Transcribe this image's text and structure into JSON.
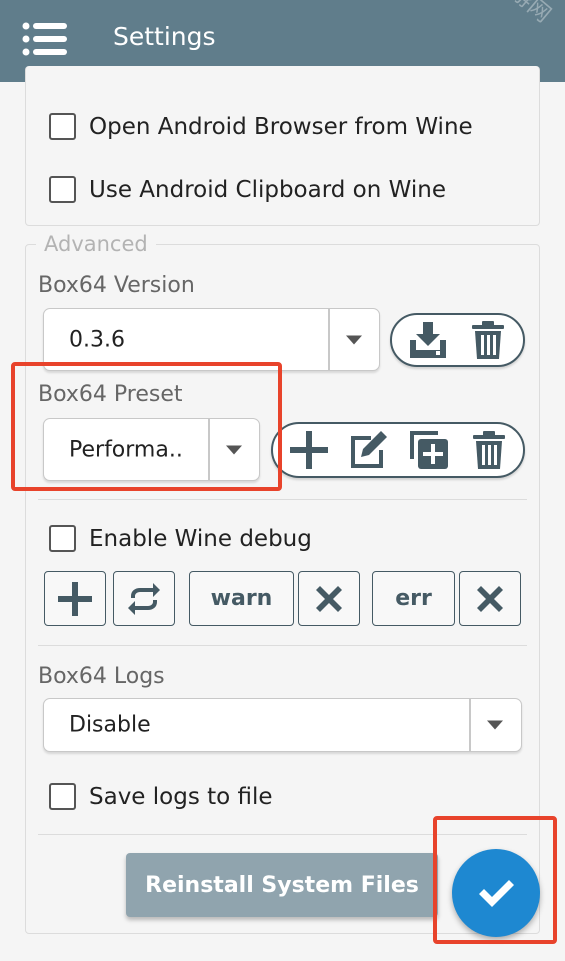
{
  "app_bar": {
    "title": "Settings",
    "menu_icon": "hamburger-menu-icon",
    "watermark": "新华手游网",
    "color": "#607d8b"
  },
  "general": {
    "open_browser_label": "Open Android Browser from Wine",
    "open_browser_checked": false,
    "use_clipboard_label": "Use Android Clipboard on Wine",
    "use_clipboard_checked": false
  },
  "advanced": {
    "legend": "Advanced",
    "box64_version": {
      "label": "Box64 Version",
      "value": "0.3.6",
      "actions": [
        "download-icon",
        "trash-icon"
      ]
    },
    "box64_preset": {
      "label": "Box64 Preset",
      "value": "Performa..",
      "actions": [
        "add-icon",
        "edit-icon",
        "duplicate-icon",
        "trash-icon"
      ]
    },
    "wine_debug": {
      "label": "Enable Wine debug",
      "checked": false,
      "channels": [
        {
          "name": "warn",
          "remove_icon": "close-icon"
        },
        {
          "name": "err",
          "remove_icon": "close-icon"
        }
      ]
    },
    "box64_logs": {
      "label": "Box64 Logs",
      "value": "Disable"
    },
    "save_logs": {
      "label": "Save logs to file",
      "checked": false
    }
  },
  "footer": {
    "reinstall_label": "Reinstall System Files",
    "confirm_icon": "check-icon"
  },
  "colors": {
    "accent": "#1e88d1",
    "icon": "#455a64",
    "highlight": "#e8432b",
    "button": "#90a4ae"
  }
}
